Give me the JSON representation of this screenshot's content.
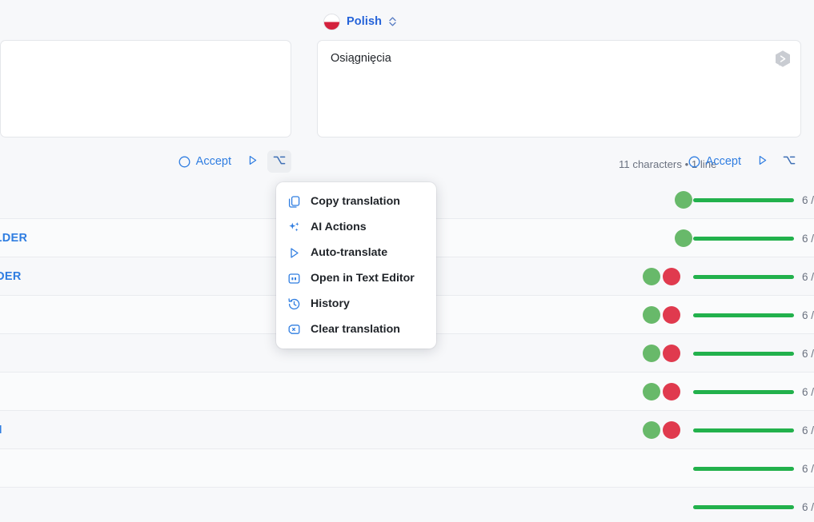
{
  "editor": {
    "source_pane": {
      "text": "",
      "accept_label": "Accept",
      "play_icon": "play-icon",
      "option_icon": "option-key-icon"
    },
    "target_pane": {
      "language": "Polish",
      "flag_icon": "poland-flag-icon",
      "chevron_icon": "chevron-updown-icon",
      "text": "Osiągnięcia",
      "badge_icon": "hex-play-badge-icon",
      "counter": "11 characters • 1 line",
      "accept_label": "Accept",
      "play_icon": "play-icon",
      "option_icon": "option-key-icon"
    }
  },
  "context_menu": {
    "items": [
      {
        "label": "Copy translation",
        "icon": "copy-icon"
      },
      {
        "label": "AI Actions",
        "icon": "sparkles-icon"
      },
      {
        "label": "Auto-translate",
        "icon": "play-icon"
      },
      {
        "label": "Open in Text Editor",
        "icon": "text-editor-icon"
      },
      {
        "label": "History",
        "icon": "history-icon"
      },
      {
        "label": "Clear translation",
        "icon": "clear-tag-icon"
      }
    ]
  },
  "table": {
    "rows": [
      {
        "key": "",
        "dots": [
          "green"
        ],
        "bar": true,
        "count": "6 /"
      },
      {
        "key": "OLDER",
        "dots": [
          "green"
        ],
        "bar": true,
        "count": "6 /"
      },
      {
        "key": "LDER",
        "dots": [
          "green",
          "red"
        ],
        "bar": true,
        "count": "6 /"
      },
      {
        "key": "",
        "dots": [
          "green",
          "red"
        ],
        "bar": true,
        "count": "6 /"
      },
      {
        "key": "|",
        "dots": [
          "green",
          "red"
        ],
        "bar": true,
        "count": "6 /"
      },
      {
        "key": "",
        "dots": [
          "green",
          "red"
        ],
        "bar": true,
        "count": "6 /"
      },
      {
        "key": "N",
        "dots": [
          "green",
          "red"
        ],
        "bar": true,
        "count": "6 /"
      },
      {
        "key": "",
        "dots": [],
        "bar": true,
        "count": "6 /"
      },
      {
        "key": "",
        "dots": [],
        "bar": true,
        "count": "6 /"
      }
    ]
  },
  "colors": {
    "accent": "#2f7de1",
    "green": "#22b14c",
    "dot_green": "#68b96a",
    "dot_red": "#e03a4e",
    "flag_red": "#d4213d"
  }
}
